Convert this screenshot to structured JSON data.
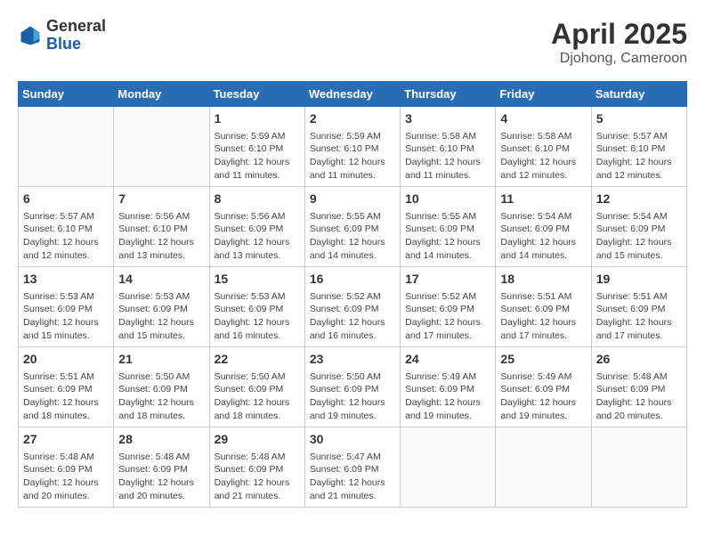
{
  "header": {
    "logo_general": "General",
    "logo_blue": "Blue",
    "title": "April 2025",
    "subtitle": "Djohong, Cameroon"
  },
  "weekdays": [
    "Sunday",
    "Monday",
    "Tuesday",
    "Wednesday",
    "Thursday",
    "Friday",
    "Saturday"
  ],
  "weeks": [
    [
      {
        "day": "",
        "info": ""
      },
      {
        "day": "",
        "info": ""
      },
      {
        "day": "1",
        "info": "Sunrise: 5:59 AM\nSunset: 6:10 PM\nDaylight: 12 hours and 11 minutes."
      },
      {
        "day": "2",
        "info": "Sunrise: 5:59 AM\nSunset: 6:10 PM\nDaylight: 12 hours and 11 minutes."
      },
      {
        "day": "3",
        "info": "Sunrise: 5:58 AM\nSunset: 6:10 PM\nDaylight: 12 hours and 11 minutes."
      },
      {
        "day": "4",
        "info": "Sunrise: 5:58 AM\nSunset: 6:10 PM\nDaylight: 12 hours and 12 minutes."
      },
      {
        "day": "5",
        "info": "Sunrise: 5:57 AM\nSunset: 6:10 PM\nDaylight: 12 hours and 12 minutes."
      }
    ],
    [
      {
        "day": "6",
        "info": "Sunrise: 5:57 AM\nSunset: 6:10 PM\nDaylight: 12 hours and 12 minutes."
      },
      {
        "day": "7",
        "info": "Sunrise: 5:56 AM\nSunset: 6:10 PM\nDaylight: 12 hours and 13 minutes."
      },
      {
        "day": "8",
        "info": "Sunrise: 5:56 AM\nSunset: 6:09 PM\nDaylight: 12 hours and 13 minutes."
      },
      {
        "day": "9",
        "info": "Sunrise: 5:55 AM\nSunset: 6:09 PM\nDaylight: 12 hours and 14 minutes."
      },
      {
        "day": "10",
        "info": "Sunrise: 5:55 AM\nSunset: 6:09 PM\nDaylight: 12 hours and 14 minutes."
      },
      {
        "day": "11",
        "info": "Sunrise: 5:54 AM\nSunset: 6:09 PM\nDaylight: 12 hours and 14 minutes."
      },
      {
        "day": "12",
        "info": "Sunrise: 5:54 AM\nSunset: 6:09 PM\nDaylight: 12 hours and 15 minutes."
      }
    ],
    [
      {
        "day": "13",
        "info": "Sunrise: 5:53 AM\nSunset: 6:09 PM\nDaylight: 12 hours and 15 minutes."
      },
      {
        "day": "14",
        "info": "Sunrise: 5:53 AM\nSunset: 6:09 PM\nDaylight: 12 hours and 15 minutes."
      },
      {
        "day": "15",
        "info": "Sunrise: 5:53 AM\nSunset: 6:09 PM\nDaylight: 12 hours and 16 minutes."
      },
      {
        "day": "16",
        "info": "Sunrise: 5:52 AM\nSunset: 6:09 PM\nDaylight: 12 hours and 16 minutes."
      },
      {
        "day": "17",
        "info": "Sunrise: 5:52 AM\nSunset: 6:09 PM\nDaylight: 12 hours and 17 minutes."
      },
      {
        "day": "18",
        "info": "Sunrise: 5:51 AM\nSunset: 6:09 PM\nDaylight: 12 hours and 17 minutes."
      },
      {
        "day": "19",
        "info": "Sunrise: 5:51 AM\nSunset: 6:09 PM\nDaylight: 12 hours and 17 minutes."
      }
    ],
    [
      {
        "day": "20",
        "info": "Sunrise: 5:51 AM\nSunset: 6:09 PM\nDaylight: 12 hours and 18 minutes."
      },
      {
        "day": "21",
        "info": "Sunrise: 5:50 AM\nSunset: 6:09 PM\nDaylight: 12 hours and 18 minutes."
      },
      {
        "day": "22",
        "info": "Sunrise: 5:50 AM\nSunset: 6:09 PM\nDaylight: 12 hours and 18 minutes."
      },
      {
        "day": "23",
        "info": "Sunrise: 5:50 AM\nSunset: 6:09 PM\nDaylight: 12 hours and 19 minutes."
      },
      {
        "day": "24",
        "info": "Sunrise: 5:49 AM\nSunset: 6:09 PM\nDaylight: 12 hours and 19 minutes."
      },
      {
        "day": "25",
        "info": "Sunrise: 5:49 AM\nSunset: 6:09 PM\nDaylight: 12 hours and 19 minutes."
      },
      {
        "day": "26",
        "info": "Sunrise: 5:48 AM\nSunset: 6:09 PM\nDaylight: 12 hours and 20 minutes."
      }
    ],
    [
      {
        "day": "27",
        "info": "Sunrise: 5:48 AM\nSunset: 6:09 PM\nDaylight: 12 hours and 20 minutes."
      },
      {
        "day": "28",
        "info": "Sunrise: 5:48 AM\nSunset: 6:09 PM\nDaylight: 12 hours and 20 minutes."
      },
      {
        "day": "29",
        "info": "Sunrise: 5:48 AM\nSunset: 6:09 PM\nDaylight: 12 hours and 21 minutes."
      },
      {
        "day": "30",
        "info": "Sunrise: 5:47 AM\nSunset: 6:09 PM\nDaylight: 12 hours and 21 minutes."
      },
      {
        "day": "",
        "info": ""
      },
      {
        "day": "",
        "info": ""
      },
      {
        "day": "",
        "info": ""
      }
    ]
  ]
}
